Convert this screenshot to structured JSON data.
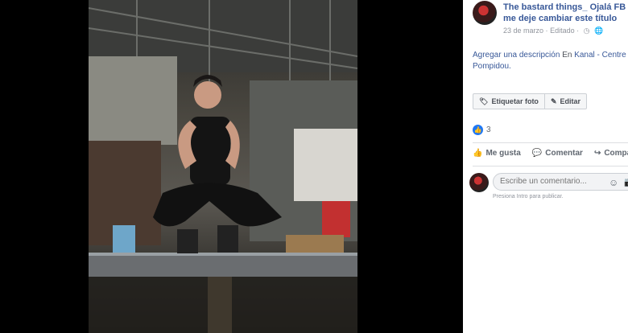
{
  "post": {
    "author": "The bastard things_ Ojalá FB O",
    "author_line2": "me deje cambiar este título",
    "date": "23 de marzo",
    "edited": "Editado",
    "separator": "·",
    "description_link": "Agregar una descripción",
    "location_prefix": "En",
    "location": "Kanal - Centre",
    "location_line2": "Pompidou."
  },
  "buttons": {
    "tag": "Etiquetar foto",
    "edit": "Editar"
  },
  "reactions": {
    "count": "3"
  },
  "actions": {
    "like": "Me gusta",
    "comment": "Comentar",
    "share": "Compartir"
  },
  "comment": {
    "placeholder": "Escribe un comentario...",
    "hint": "Presiona Intro para publicar."
  }
}
